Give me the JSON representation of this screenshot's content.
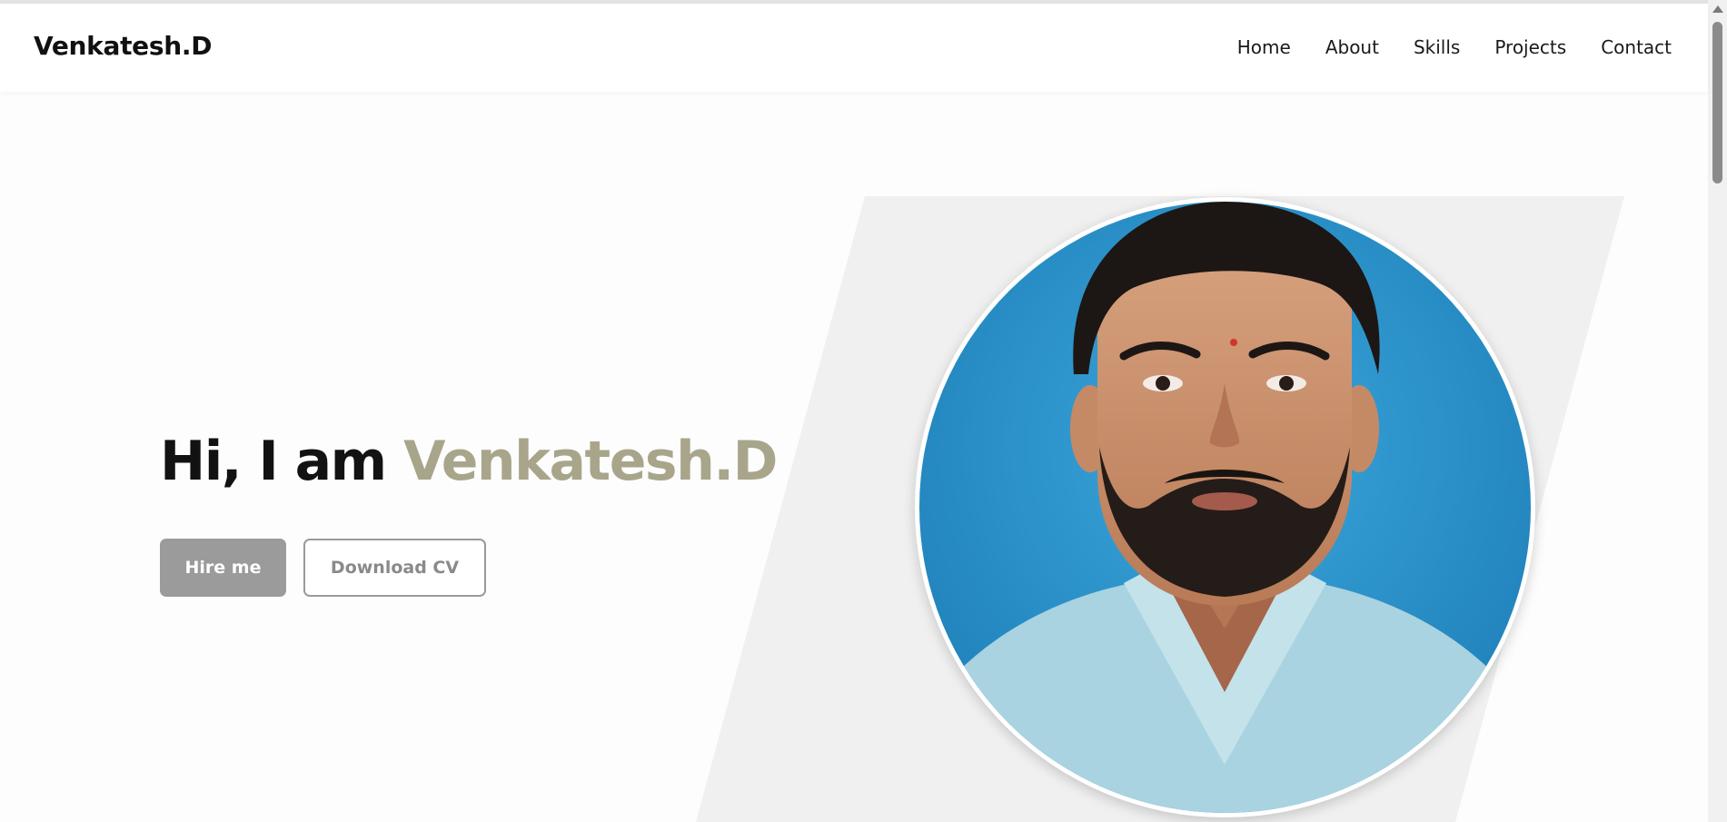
{
  "brand": {
    "name": "Venkatesh.D"
  },
  "nav": {
    "items": [
      {
        "label": "Home"
      },
      {
        "label": "About"
      },
      {
        "label": "Skills"
      },
      {
        "label": "Projects"
      },
      {
        "label": "Contact"
      }
    ]
  },
  "hero": {
    "greeting": "Hi, I am",
    "name": "Venkatesh.D",
    "buttons": {
      "hire": "Hire me",
      "cv": "Download CV"
    }
  },
  "colors": {
    "accent": "#a8a58b",
    "hire_button_bg": "#9b9b9b",
    "slant_panel": "#f0f0f0",
    "photo_backdrop": "#2f9bd2",
    "shirt": "#a9d3e0"
  },
  "icons": {
    "scroll_up": "scroll-up-arrow-icon"
  }
}
